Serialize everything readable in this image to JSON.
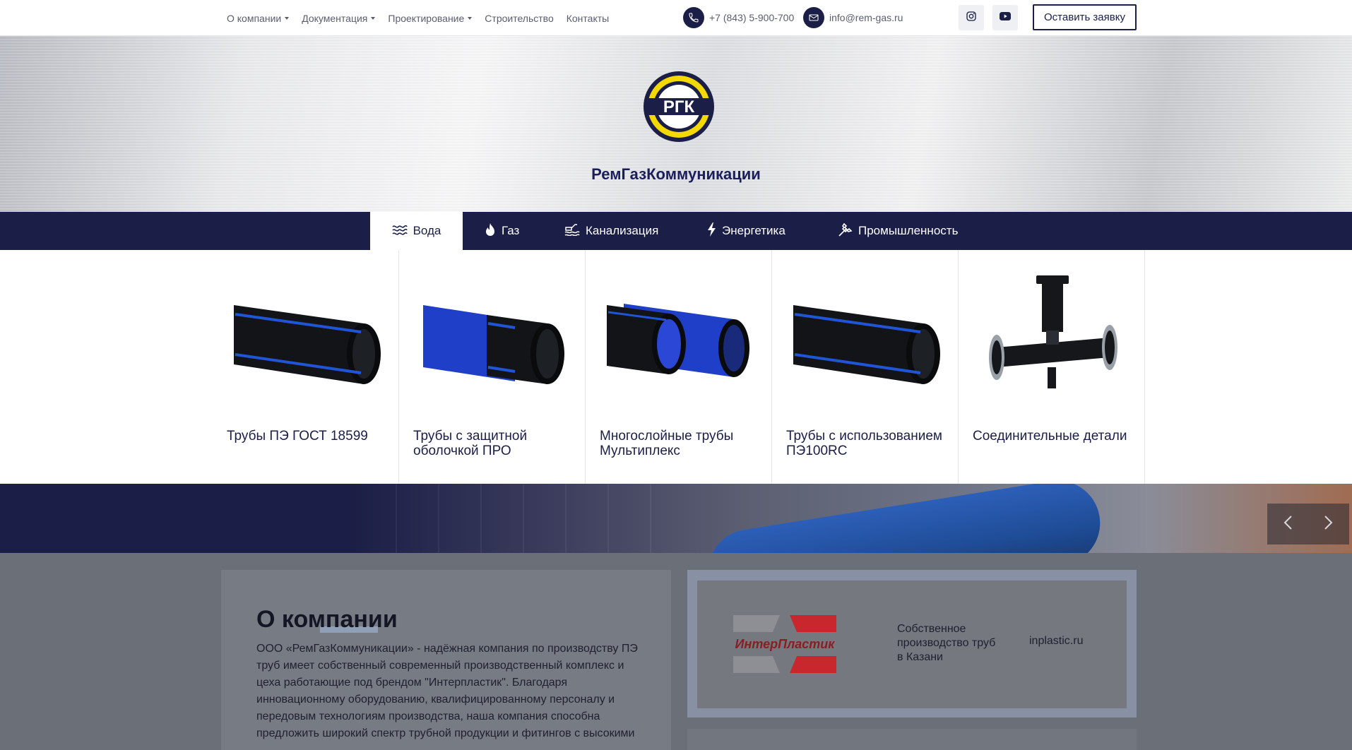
{
  "nav": {
    "items": [
      {
        "label": "О компании",
        "dropdown": true
      },
      {
        "label": "Документация",
        "dropdown": true
      },
      {
        "label": "Проектирование",
        "dropdown": true
      },
      {
        "label": "Строительство",
        "dropdown": false
      },
      {
        "label": "Контакты",
        "dropdown": false
      }
    ]
  },
  "contacts": {
    "phone": "+7 (843) 5-900-700",
    "email": "info@rem-gas.ru"
  },
  "social": {
    "instagram_icon": "instagram-icon",
    "youtube_icon": "youtube-icon"
  },
  "cta_label": "Оставить заявку",
  "hero": {
    "logo_text": "РГК",
    "brand": "РемГазКоммуникации"
  },
  "categories": [
    {
      "label": "Вода",
      "icon": "water-waves-icon",
      "active": true
    },
    {
      "label": "Газ",
      "icon": "flame-icon",
      "active": false
    },
    {
      "label": "Канализация",
      "icon": "sewer-icon",
      "active": false
    },
    {
      "label": "Энергетика",
      "icon": "lightning-icon",
      "active": false
    },
    {
      "label": "Промышленность",
      "icon": "hammer-icon",
      "active": false
    }
  ],
  "products": [
    {
      "title": "Трубы ПЭ ГОСТ 18599",
      "image": "black-pipe-blue-stripes"
    },
    {
      "title": "Трубы с защитной оболочкой ПРО",
      "image": "blue-sheathed-pipe"
    },
    {
      "title": "Многослойные трубы Мультиплекс",
      "image": "multilayer-blue-pipe"
    },
    {
      "title": "Трубы с использованием ПЭ100RC",
      "image": "black-pipe-blue-stripes"
    },
    {
      "title": "Соединительные детали",
      "image": "flanged-tee-fitting"
    }
  ],
  "about": {
    "heading": "О компании",
    "text": "ООО «РемГазКоммуникации» - надёжная компания по производству ПЭ труб имеет собственный современный производственный комплекс и цеха работающие под брендом \"Интерпластик\". Благодаря инновационному оборудованию, квалифицированному персоналу и передовым технологиям производства, наша компания способна предложить широкий спектр трубной продукции и фитингов с высокими"
  },
  "partner": {
    "logo_text": "ИнтерПластик",
    "text": "Собственное производство труб в Казани",
    "link": "inplastic.ru"
  },
  "colors": {
    "navy": "#1b1e46",
    "accent_blue": "#2350c8",
    "partner_red": "#c8272d"
  }
}
